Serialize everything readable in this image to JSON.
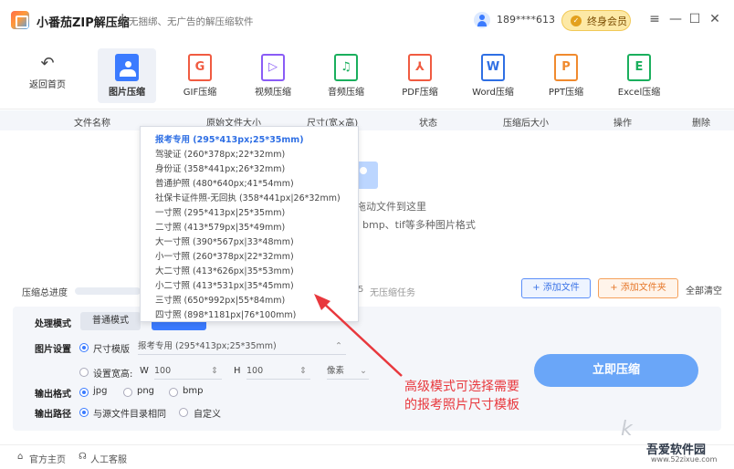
{
  "titlebar": {
    "app_name": "小番茄ZIP解压缩",
    "separator": "|",
    "slogan": "无捆绑、无广告的解压缩软件",
    "user_phone": "189****613",
    "vip_label": "终身会员",
    "menu_icon": "≡",
    "min_icon": "—",
    "max_icon": "☐",
    "close_icon": "✕"
  },
  "toolbar": {
    "back_label": "返回首页",
    "tools": [
      {
        "label": "图片压缩",
        "letter": "",
        "color": "#3b7bff"
      },
      {
        "label": "GIF压缩",
        "letter": "G",
        "color": "#f05b41"
      },
      {
        "label": "视频压缩",
        "letter": "▷",
        "color": "#8a5cf6"
      },
      {
        "label": "音频压缩",
        "letter": "♫",
        "color": "#1aaf5d"
      },
      {
        "label": "PDF压缩",
        "letter": "⅄",
        "color": "#f05b41"
      },
      {
        "label": "Word压缩",
        "letter": "W",
        "color": "#2f6fe4"
      },
      {
        "label": "PPT压缩",
        "letter": "P",
        "color": "#f08a2e"
      },
      {
        "label": "Excel压缩",
        "letter": "E",
        "color": "#1aaf5d"
      }
    ]
  },
  "table": {
    "headers": [
      "文件名称",
      "原始文件大小",
      "尺寸(宽×高)",
      "状态",
      "压缩后大小",
      "操作",
      "删除"
    ]
  },
  "drop_area": {
    "hint_line1": "拖动文件到这里",
    "hint_line2": "bmp、tif等多种图片格式"
  },
  "progress": {
    "label": "压缩总进度",
    "count": "5",
    "status": "无压缩任务"
  },
  "actions": {
    "add_file": "+ 添加文件",
    "add_folder": "+ 添加文件夹",
    "clear_all": "全部清空"
  },
  "settings": {
    "mode_label": "处理模式",
    "mode_normal": "普通模式",
    "image_label": "图片设置",
    "size_template": "尺寸模版",
    "template_value": "报考专用 (295*413px;25*35mm)",
    "set_wh": "设置宽高:",
    "w_label": "W",
    "w_value": "100",
    "h_label": "H",
    "h_value": "100",
    "unit": "像素",
    "format_label": "输出格式",
    "formats": [
      "jpg",
      "png",
      "bmp"
    ],
    "path_label": "输出路径",
    "path_same": "与源文件目录相同",
    "path_custom": "自定义",
    "compress_button": "立即压缩"
  },
  "statusbar": {
    "home": "官方主页",
    "support": "人工客服"
  },
  "dropdown": {
    "items": [
      "报考专用 (295*413px;25*35mm)",
      "驾驶证 (260*378px;22*32mm)",
      "身份证 (358*441px;26*32mm)",
      "普通护照 (480*640px;41*54mm)",
      "社保卡证件照-无回执 (358*441px|26*32mm)",
      "一寸照 (295*413px|25*35mm)",
      "二寸照 (413*579px|35*49mm)",
      "大一寸照 (390*567px|33*48mm)",
      "小一寸照 (260*378px|22*32mm)",
      "大二寸照 (413*626px|35*53mm)",
      "小二寸照 (413*531px|35*45mm)",
      "三寸照 (650*992px|55*84mm)",
      "四寸照 (898*1181px|76*100mm)"
    ]
  },
  "callout": {
    "line1": "高级模式可选择需要",
    "line2": "的报考照片尺寸模板",
    "color": "#e8383d"
  },
  "watermark": {
    "main": "吾爱软件园",
    "sub": "www.52zixue.com",
    "mark": "k"
  }
}
